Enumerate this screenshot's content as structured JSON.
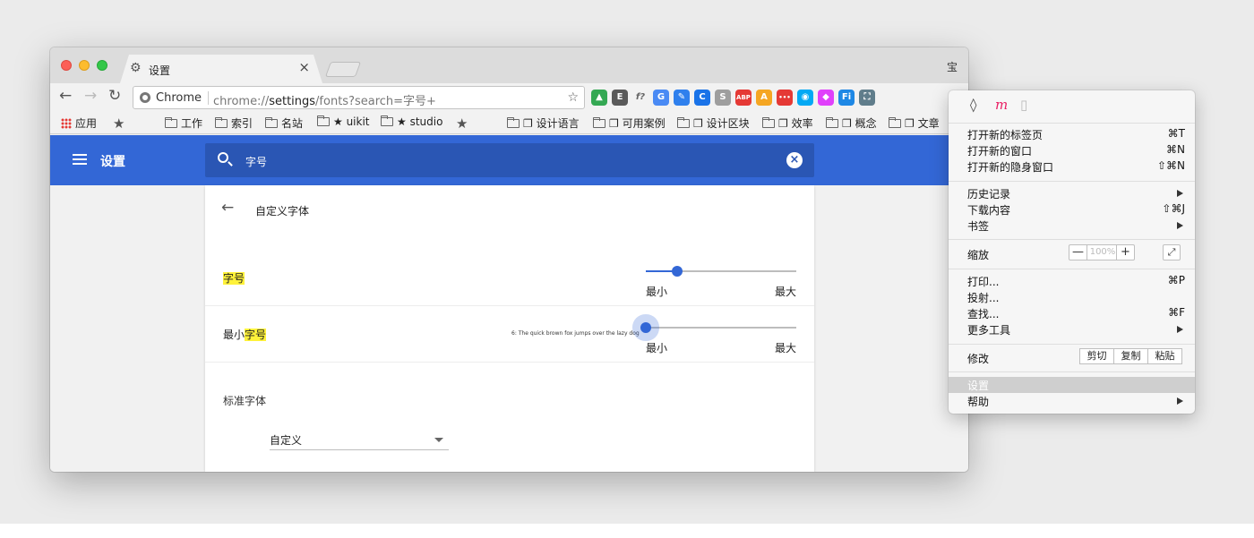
{
  "browser": {
    "profile": "宝",
    "tab": {
      "title": "设置"
    },
    "omnibox": {
      "chip": "Chrome",
      "url_prefix": "chrome://",
      "url_host": "settings",
      "url_path": "/fonts?search=字号+"
    }
  },
  "bookmarks": [
    {
      "label": "应用",
      "icon": "apps-grid-icon"
    },
    {
      "label": "",
      "icon": "star-icon"
    },
    {
      "label": "工作",
      "icon": "folder-icon"
    },
    {
      "label": "索引",
      "icon": "folder-icon"
    },
    {
      "label": "名站",
      "icon": "folder-icon"
    },
    {
      "label": "★ uikit",
      "icon": "folder-icon"
    },
    {
      "label": "★ studio",
      "icon": "folder-icon"
    },
    {
      "label": "",
      "icon": "star-icon"
    },
    {
      "label": "❐ 设计语言",
      "icon": "folder-icon"
    },
    {
      "label": "❐ 可用案例",
      "icon": "folder-icon"
    },
    {
      "label": "❐ 设计区块",
      "icon": "folder-icon"
    },
    {
      "label": "❐ 效率",
      "icon": "folder-icon"
    },
    {
      "label": "❐ 概念",
      "icon": "folder-icon"
    },
    {
      "label": "❐ 文章",
      "icon": "folder-icon"
    }
  ],
  "extensions": [
    {
      "name": "drive-icon",
      "color": "#34a853",
      "glyph": "▲"
    },
    {
      "name": "evernote-icon",
      "color": "#5a5a5a",
      "glyph": "E"
    },
    {
      "name": "formula-icon",
      "color": "#f2f2f2",
      "glyph": "f?"
    },
    {
      "name": "translate-icon",
      "color": "#4a8af4",
      "glyph": "G"
    },
    {
      "name": "edit-icon",
      "color": "#2f80ed",
      "glyph": "✎"
    },
    {
      "name": "refresh-ext-icon",
      "color": "#1a73e8",
      "glyph": "C"
    },
    {
      "name": "s-ext-icon",
      "color": "#9e9e9e",
      "glyph": "S"
    },
    {
      "name": "adblock-icon",
      "color": "#e53935",
      "glyph": "ABP"
    },
    {
      "name": "fonts-ext-icon",
      "color": "#f5a623",
      "glyph": "A"
    },
    {
      "name": "dots-ext-icon",
      "color": "#e53935",
      "glyph": "•••"
    },
    {
      "name": "eye-ext-icon",
      "color": "#03a9f4",
      "glyph": "◉"
    },
    {
      "name": "shape-ext-icon",
      "color": "#e040fb",
      "glyph": "◆"
    },
    {
      "name": "fi-ext-icon",
      "color": "#1e88e5",
      "glyph": "Fi"
    },
    {
      "name": "screenshot-icon",
      "color": "#607d8b",
      "glyph": "⛶"
    }
  ],
  "settings": {
    "header_title": "设置",
    "search_value": "字号",
    "page_title": "自定义字体",
    "font_size": {
      "label": "字号",
      "min_label": "最小",
      "max_label": "最大",
      "value_fraction": 0.21
    },
    "min_font_size": {
      "label_prefix": "最小",
      "label_highlight": "字号",
      "min_label": "最小",
      "max_label": "最大",
      "value_fraction": 0.0,
      "preview": "6: The quick brown fox jumps over the lazy dog"
    },
    "standard_font": {
      "label": "标准字体",
      "value": "自定义"
    }
  },
  "menu": {
    "extensions": [
      {
        "name": "sketch-ext-icon",
        "glyph": "◊"
      },
      {
        "name": "m-ext-icon",
        "glyph": "m"
      },
      {
        "name": "pdf-ext-icon",
        "glyph": "▯"
      }
    ],
    "new_tab": {
      "label": "打开新的标签页",
      "shortcut": "⌘T"
    },
    "new_window": {
      "label": "打开新的窗口",
      "shortcut": "⌘N"
    },
    "incognito": {
      "label": "打开新的隐身窗口",
      "shortcut": "⇧⌘N"
    },
    "history": {
      "label": "历史记录"
    },
    "downloads": {
      "label": "下载内容",
      "shortcut": "⇧⌘J"
    },
    "bookmarks": {
      "label": "书签"
    },
    "zoom": {
      "label": "缩放",
      "minus": "—",
      "value": "100%",
      "plus": "+",
      "fullscreen": "⤢"
    },
    "print": {
      "label": "打印...",
      "shortcut": "⌘P"
    },
    "cast": {
      "label": "投射..."
    },
    "find": {
      "label": "查找...",
      "shortcut": "⌘F"
    },
    "more_tools": {
      "label": "更多工具"
    },
    "edit": {
      "label": "修改",
      "cut": "剪切",
      "copy": "复制",
      "paste": "粘贴"
    },
    "settings": {
      "label": "设置"
    },
    "help": {
      "label": "帮助"
    }
  }
}
